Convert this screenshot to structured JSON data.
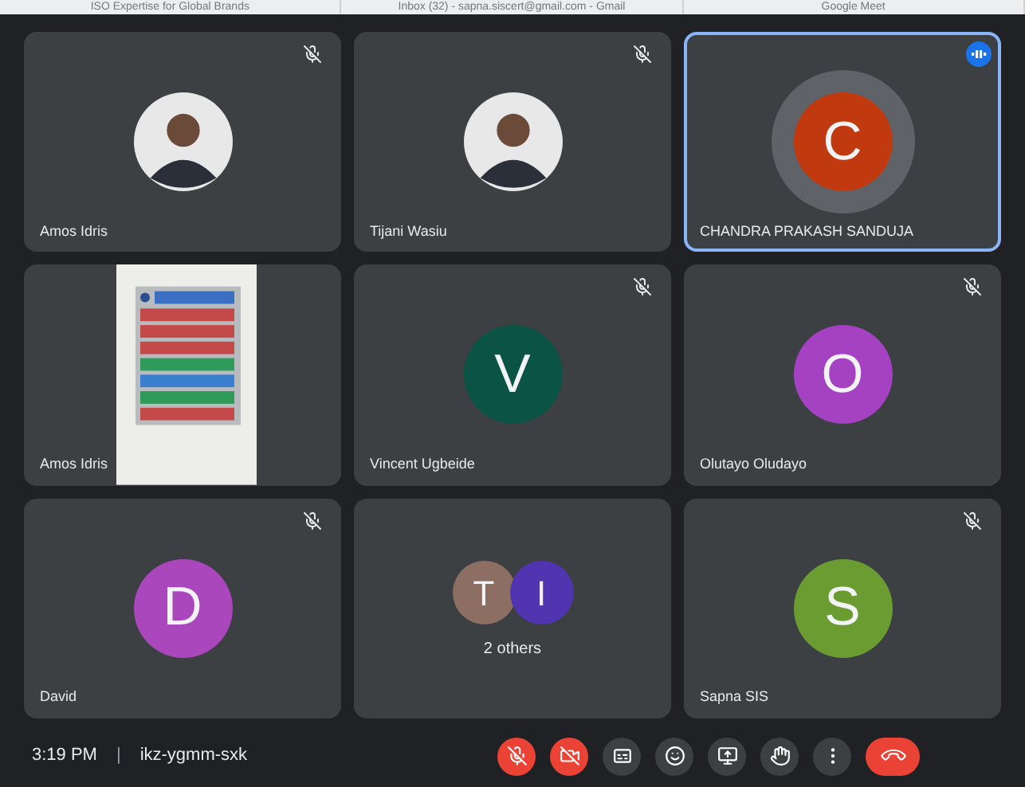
{
  "browser_tabs": [
    {
      "title": "ISO Expertise for Global Brands"
    },
    {
      "title": "Inbox (32) - sapna.siscert@gmail.com - Gmail"
    },
    {
      "title": "Google Meet"
    }
  ],
  "tiles": [
    {
      "name": "Amos Idris",
      "muted": true,
      "active": false
    },
    {
      "name": "Tijani Wasiu",
      "muted": true,
      "active": false
    },
    {
      "kind": "letter",
      "name": "CHANDRA PRAKASH SANDUJA",
      "initial": "C",
      "color": "#c0390f",
      "muted": false,
      "active": true
    },
    {
      "kind": "video",
      "name": "Amos Idris",
      "muted": false,
      "active": false
    },
    {
      "kind": "letter",
      "name": "Vincent Ugbeide",
      "initial": "V",
      "color": "#0b5345",
      "muted": true,
      "active": false
    },
    {
      "kind": "letter",
      "name": "Olutayo Oludayo",
      "initial": "O",
      "color": "#a442c2",
      "muted": true,
      "active": false
    },
    {
      "kind": "letter",
      "name": "David",
      "initial": "D",
      "color": "#ab47bc",
      "muted": true,
      "active": false
    },
    {
      "kind": "group",
      "label": "2 others",
      "members": [
        {
          "initial": "T",
          "color": "#8d6e63"
        },
        {
          "initial": "I",
          "color": "#5134b0"
        }
      ],
      "muted": false,
      "active": false
    },
    {
      "kind": "letter",
      "name": "Sapna SIS",
      "initial": "S",
      "color": "#6a9c32",
      "muted": true,
      "active": false
    }
  ],
  "footer": {
    "time": "3:19 PM",
    "separator": "|",
    "meeting_code": "ikz-ygmm-sxk"
  },
  "controls": [
    {
      "kind": "mic",
      "alert": true
    },
    {
      "kind": "camera",
      "alert": true
    },
    {
      "kind": "captions",
      "alert": false
    },
    {
      "kind": "emoji",
      "alert": false
    },
    {
      "kind": "present",
      "alert": false
    },
    {
      "kind": "hand",
      "alert": false
    },
    {
      "kind": "more",
      "alert": false
    },
    {
      "kind": "end",
      "alert": true
    }
  ]
}
